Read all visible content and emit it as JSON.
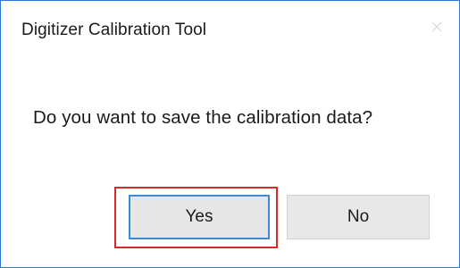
{
  "dialog": {
    "title": "Digitizer Calibration Tool",
    "close_icon": "close-icon",
    "message": "Do you want to save the calibration data?",
    "buttons": {
      "yes_label": "Yes",
      "no_label": "No"
    }
  },
  "colors": {
    "window_border": "#2b79d6",
    "focus_border": "#3b8bd8",
    "highlight_annotation": "#d62b2b",
    "button_face": "#e5e5e5"
  }
}
